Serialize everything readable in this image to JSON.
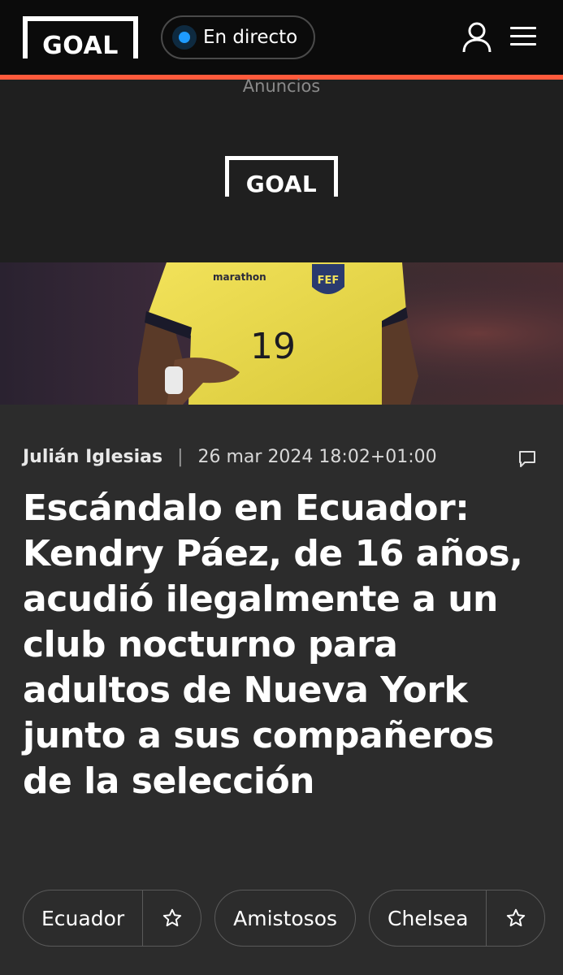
{
  "header": {
    "logo_text": "GOAL",
    "live_label": "En directo"
  },
  "ad": {
    "label": "Anuncios",
    "logo_text": "GOAL"
  },
  "hero": {
    "sponsor_text": "marathon",
    "shirt_number": "19"
  },
  "article": {
    "author": "Julián Iglesias",
    "separator": "|",
    "date": "26 mar 2024 18:02+01:00",
    "headline": "Escándalo en Ecuador: Kendry Páez, de 16 años, acudió ilegalmente a un club nocturno para adultos de Nueva York junto a sus compañeros de la selección"
  },
  "tags": [
    {
      "label": "Ecuador"
    },
    {
      "label": "Amistosos"
    },
    {
      "label": "Chelsea"
    }
  ],
  "colors": {
    "accent": "#ff5a3c",
    "live_dot": "#1e9bff",
    "background": "#2c2c2c",
    "header": "#0b0b0b"
  }
}
